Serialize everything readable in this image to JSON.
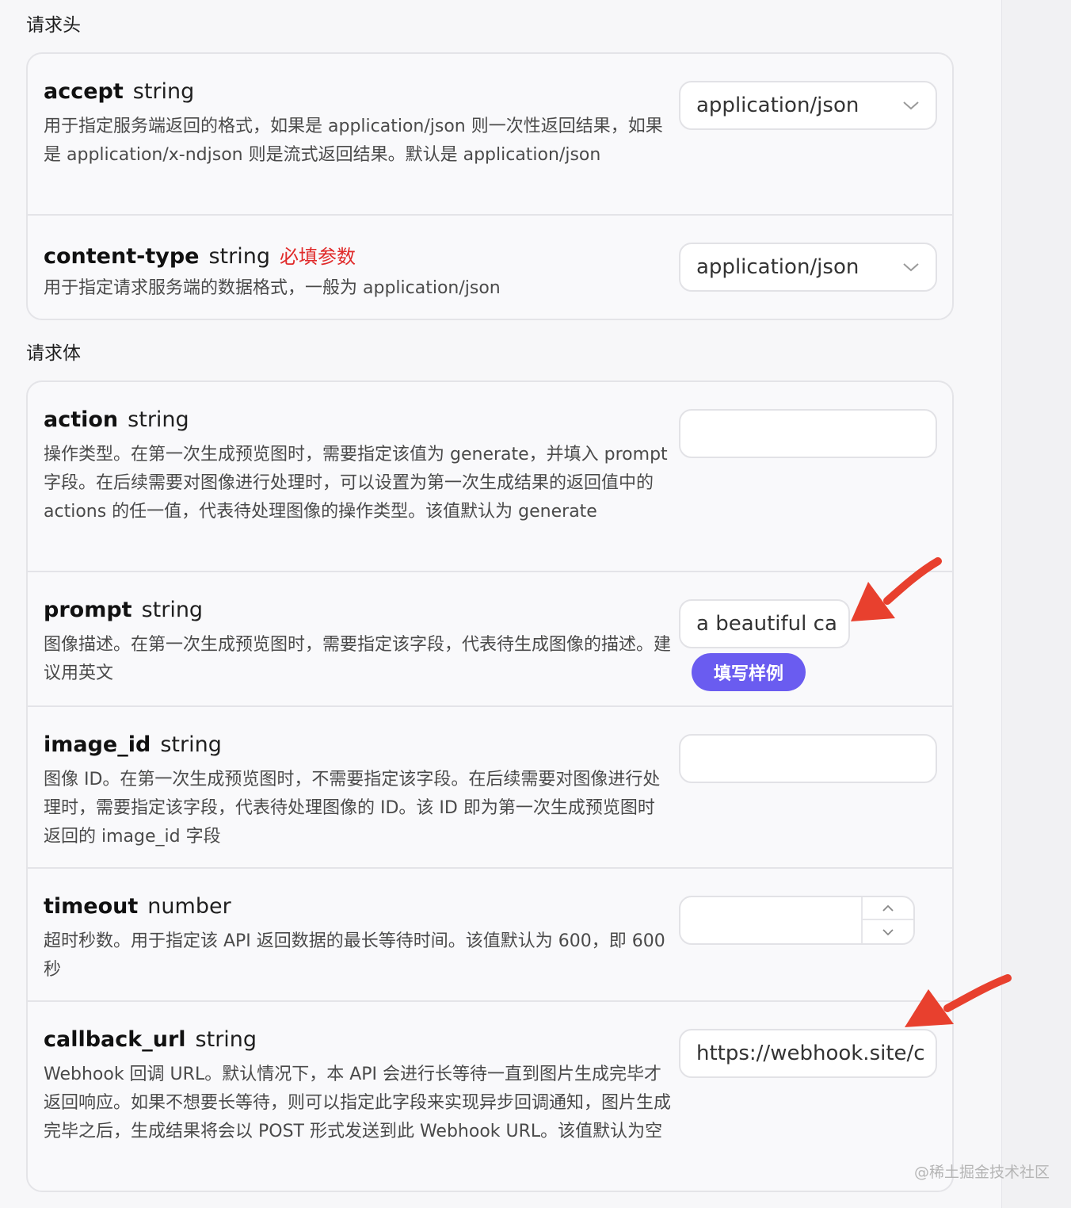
{
  "headers_section": {
    "title": "请求头",
    "fields": [
      {
        "name": "accept",
        "type": "string",
        "description": "用于指定服务端返回的格式，如果是 application/json 则一次性返回结果，如果是 application/x-ndjson 则是流式返回结果。默认是 application/json",
        "value": "application/json"
      },
      {
        "name": "content-type",
        "type": "string",
        "required_label": "必填参数",
        "description": "用于指定请求服务端的数据格式，一般为 application/json",
        "value": "application/json"
      }
    ]
  },
  "body_section": {
    "title": "请求体",
    "fields": [
      {
        "name": "action",
        "type": "string",
        "description": "操作类型。在第一次生成预览图时，需要指定该值为 generate，并填入 prompt 字段。在后续需要对图像进行处理时，可以设置为第一次生成结果的返回值中的 actions 的任一值，代表待处理图像的操作类型。该值默认为 generate",
        "value": ""
      },
      {
        "name": "prompt",
        "type": "string",
        "description": "图像描述。在第一次生成预览图时，需要指定该字段，代表待生成图像的描述。建议用英文",
        "value": "a beautiful ca",
        "sample_button": "填写样例"
      },
      {
        "name": "image_id",
        "type": "string",
        "description": "图像 ID。在第一次生成预览图时，不需要指定该字段。在后续需要对图像进行处理时，需要指定该字段，代表待处理图像的 ID。该 ID 即为第一次生成预览图时返回的 image_id 字段",
        "value": ""
      },
      {
        "name": "timeout",
        "type": "number",
        "description": "超时秒数。用于指定该 API 返回数据的最长等待时间。该值默认为 600，即 600 秒",
        "value": ""
      },
      {
        "name": "callback_url",
        "type": "string",
        "description": "Webhook 回调 URL。默认情况下，本 API 会进行长等待一直到图片生成完毕才返回响应。如果不想要长等待，则可以指定此字段来实现异步回调通知，图片生成完毕之后，生成结果将会以 POST 形式发送到此 Webhook URL。该值默认为空",
        "value": "https://webhook.site/c"
      }
    ]
  },
  "watermark": "@稀土掘金技术社区",
  "colors": {
    "required": "#e02a2a",
    "sample_button": "#6a5cf0",
    "annotation_arrow": "#e8402e"
  },
  "icons": [
    "chevron-down-icon",
    "chevron-up-icon",
    "annotation-arrow"
  ]
}
